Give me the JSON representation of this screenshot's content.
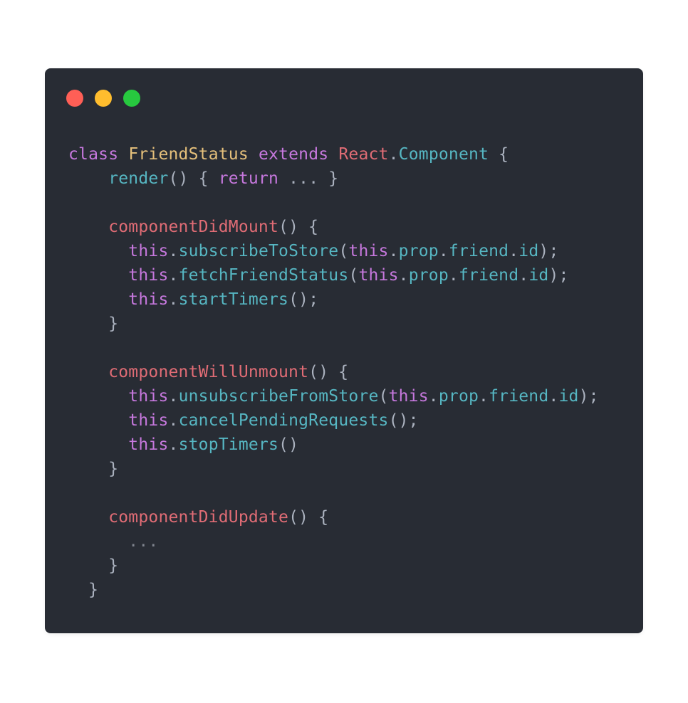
{
  "window": {
    "background": "#282c34",
    "traffic_lights": [
      {
        "name": "close",
        "color": "#ff5f56"
      },
      {
        "name": "minimize",
        "color": "#ffbd2e"
      },
      {
        "name": "maximize",
        "color": "#27c93f"
      }
    ]
  },
  "colors": {
    "keyword": "#c678dd",
    "class_name": "#e5c07b",
    "react": "#e06c75",
    "method": "#56b6c2",
    "lifecycle": "#e06c75",
    "punct": "#abb2bf",
    "this": "#c678dd",
    "comment": "#7f848e"
  },
  "code": {
    "lines": [
      [
        {
          "t": "class",
          "c": "keyword"
        },
        {
          "t": " ",
          "c": "punct"
        },
        {
          "t": "FriendStatus",
          "c": "class_name"
        },
        {
          "t": " ",
          "c": "punct"
        },
        {
          "t": "extends",
          "c": "keyword"
        },
        {
          "t": " ",
          "c": "punct"
        },
        {
          "t": "React",
          "c": "react"
        },
        {
          "t": ".",
          "c": "punct"
        },
        {
          "t": "Component",
          "c": "method"
        },
        {
          "t": " {",
          "c": "punct"
        }
      ],
      [
        {
          "t": "    ",
          "c": "punct"
        },
        {
          "t": "render",
          "c": "method"
        },
        {
          "t": "() { ",
          "c": "punct"
        },
        {
          "t": "return",
          "c": "keyword"
        },
        {
          "t": " ... }",
          "c": "punct"
        }
      ],
      [],
      [
        {
          "t": "    ",
          "c": "punct"
        },
        {
          "t": "componentDidMount",
          "c": "lifecycle"
        },
        {
          "t": "() {",
          "c": "punct"
        }
      ],
      [
        {
          "t": "      ",
          "c": "punct"
        },
        {
          "t": "this",
          "c": "this"
        },
        {
          "t": ".",
          "c": "punct"
        },
        {
          "t": "subscribeToStore",
          "c": "method"
        },
        {
          "t": "(",
          "c": "punct"
        },
        {
          "t": "this",
          "c": "this"
        },
        {
          "t": ".",
          "c": "punct"
        },
        {
          "t": "prop",
          "c": "method"
        },
        {
          "t": ".",
          "c": "punct"
        },
        {
          "t": "friend",
          "c": "method"
        },
        {
          "t": ".",
          "c": "punct"
        },
        {
          "t": "id",
          "c": "method"
        },
        {
          "t": ");",
          "c": "punct"
        }
      ],
      [
        {
          "t": "      ",
          "c": "punct"
        },
        {
          "t": "this",
          "c": "this"
        },
        {
          "t": ".",
          "c": "punct"
        },
        {
          "t": "fetchFriendStatus",
          "c": "method"
        },
        {
          "t": "(",
          "c": "punct"
        },
        {
          "t": "this",
          "c": "this"
        },
        {
          "t": ".",
          "c": "punct"
        },
        {
          "t": "prop",
          "c": "method"
        },
        {
          "t": ".",
          "c": "punct"
        },
        {
          "t": "friend",
          "c": "method"
        },
        {
          "t": ".",
          "c": "punct"
        },
        {
          "t": "id",
          "c": "method"
        },
        {
          "t": ");",
          "c": "punct"
        }
      ],
      [
        {
          "t": "      ",
          "c": "punct"
        },
        {
          "t": "this",
          "c": "this"
        },
        {
          "t": ".",
          "c": "punct"
        },
        {
          "t": "startTimers",
          "c": "method"
        },
        {
          "t": "();",
          "c": "punct"
        }
      ],
      [
        {
          "t": "    }",
          "c": "punct"
        }
      ],
      [],
      [
        {
          "t": "    ",
          "c": "punct"
        },
        {
          "t": "componentWillUnmount",
          "c": "lifecycle"
        },
        {
          "t": "() {",
          "c": "punct"
        }
      ],
      [
        {
          "t": "      ",
          "c": "punct"
        },
        {
          "t": "this",
          "c": "this"
        },
        {
          "t": ".",
          "c": "punct"
        },
        {
          "t": "unsubscribeFromStore",
          "c": "method"
        },
        {
          "t": "(",
          "c": "punct"
        },
        {
          "t": "this",
          "c": "this"
        },
        {
          "t": ".",
          "c": "punct"
        },
        {
          "t": "prop",
          "c": "method"
        },
        {
          "t": ".",
          "c": "punct"
        },
        {
          "t": "friend",
          "c": "method"
        },
        {
          "t": ".",
          "c": "punct"
        },
        {
          "t": "id",
          "c": "method"
        },
        {
          "t": ");",
          "c": "punct"
        }
      ],
      [
        {
          "t": "      ",
          "c": "punct"
        },
        {
          "t": "this",
          "c": "this"
        },
        {
          "t": ".",
          "c": "punct"
        },
        {
          "t": "cancelPendingRequests",
          "c": "method"
        },
        {
          "t": "();",
          "c": "punct"
        }
      ],
      [
        {
          "t": "      ",
          "c": "punct"
        },
        {
          "t": "this",
          "c": "this"
        },
        {
          "t": ".",
          "c": "punct"
        },
        {
          "t": "stopTimers",
          "c": "method"
        },
        {
          "t": "()",
          "c": "punct"
        }
      ],
      [
        {
          "t": "    }",
          "c": "punct"
        }
      ],
      [],
      [
        {
          "t": "    ",
          "c": "punct"
        },
        {
          "t": "componentDidUpdate",
          "c": "lifecycle"
        },
        {
          "t": "() {",
          "c": "punct"
        }
      ],
      [
        {
          "t": "      ",
          "c": "punct"
        },
        {
          "t": "...",
          "c": "comment"
        }
      ],
      [
        {
          "t": "    }",
          "c": "punct"
        }
      ],
      [
        {
          "t": "  }",
          "c": "punct"
        }
      ]
    ]
  }
}
